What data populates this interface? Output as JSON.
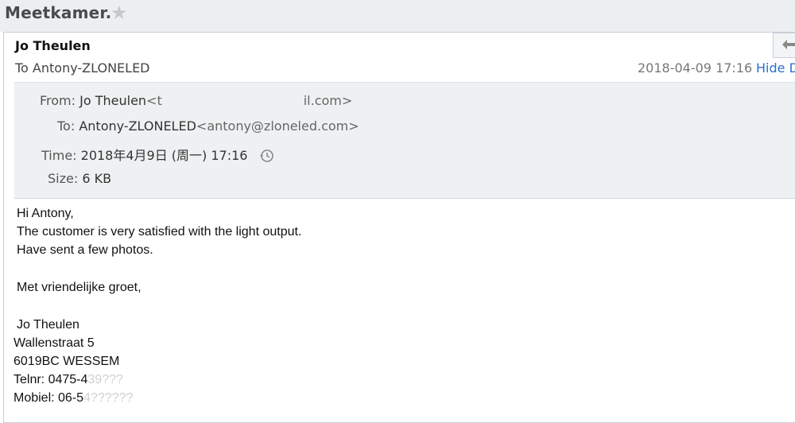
{
  "subject": "Meetkamer.",
  "sender_name": "Jo Theulen",
  "to_summary": "To Antony-ZLONELED",
  "date": "2018-04-09 17:16",
  "hide_details": "Hide D",
  "details": {
    "from_label": "From:",
    "from_name": "Jo Theulen",
    "from_addr_start": "<t",
    "from_addr_end": "il.com>",
    "to_label": "To:",
    "to_name": "Antony-ZLONELED",
    "to_addr": "<antony@zloneled.com>",
    "time_label": "Time:",
    "time_value": "2018年4月9日 (周一) 17:16",
    "size_label": "Size:",
    "size_value": "6 KB"
  },
  "body": {
    "greeting": "Hi Antony,",
    "line1": "The customer is very satisfied with the light output.",
    "line2": "Have sent a few photos.",
    "closing": "Met vriendelijke groet,",
    "sig_name": "Jo Theulen",
    "sig_street": "Wallenstraat 5",
    "sig_city": "6019BC WESSEM",
    "sig_tel_label": "Telnr: 0475-4",
    "sig_tel_rest": "39???",
    "sig_mobile_label": "Mobiel: 06-5",
    "sig_mobile_rest": "4??????"
  },
  "colors": {
    "link": "#2a6fc9",
    "details_bg": "#eef1f2",
    "topbar_bg": "#eceff2"
  },
  "icons": [
    "star-icon",
    "reply-arrow-icon",
    "history-clock-icon"
  ]
}
